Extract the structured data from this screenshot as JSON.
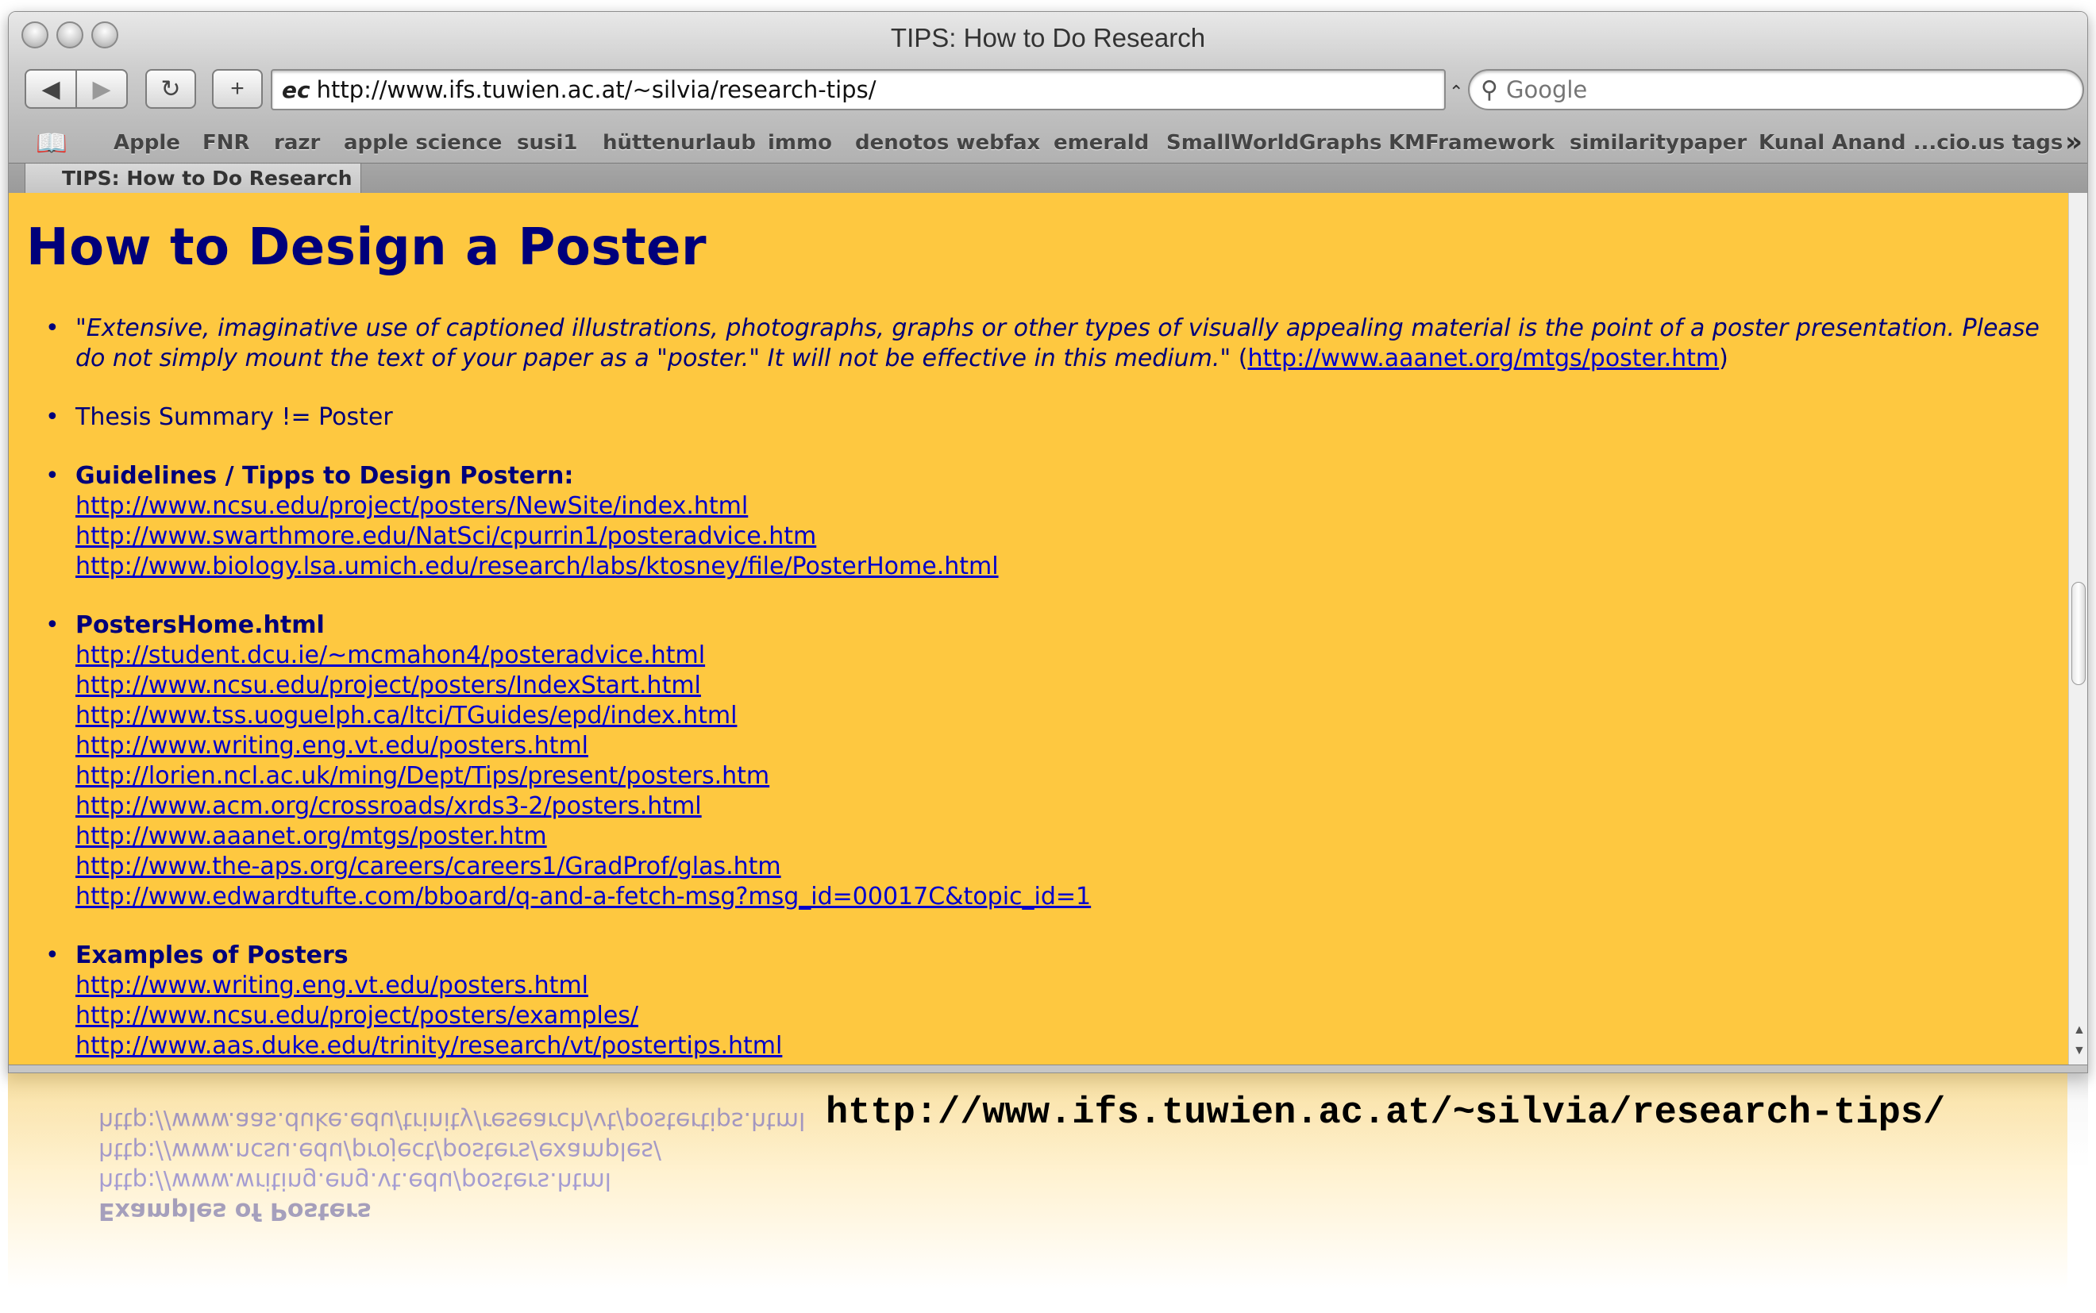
{
  "window": {
    "title": "TIPS: How to Do Research"
  },
  "toolbar": {
    "back_glyph": "◀",
    "forward_glyph": "▶",
    "reload_glyph": "↻",
    "add_glyph": "+",
    "site_icon_text": "ec",
    "address": "http://www.ifs.tuwien.ac.at/~silvia/research-tips/",
    "search_placeholder": "Google"
  },
  "bookmarks": {
    "items": [
      "Apple",
      "FNR",
      "razr",
      "apple science",
      "susi1",
      "hüttenurlaub",
      "immo",
      "denotos webfax",
      "emerald",
      "SmallWorldGraphs",
      "KMFramework",
      "similaritypaper",
      "Kunal Anand ...cio.us tags"
    ],
    "more_glyph": "»"
  },
  "tab": {
    "label": "TIPS: How to Do Research"
  },
  "page": {
    "heading": "How to Design a Poster",
    "quote_text": "\"Extensive, imaginative use of captioned illustrations, photographs, graphs or other types of visually appealing material is the point of  a poster presentation. Please do not simply mount the text of your paper as a \"poster.\" It will not be effective in this  medium.\"",
    "quote_link": "http://www.aaanet.org/mtgs/poster.htm",
    "thesis_text": "Thesis Summary != Poster",
    "guidelines": {
      "title": "Guidelines / Tipps to Design Postern:",
      "links": [
        "http://www.ncsu.edu/project/posters/NewSite/index.html",
        "http://www.swarthmore.edu/NatSci/cpurrin1/posteradvice.htm",
        "http://www.biology.lsa.umich.edu/research/labs/ktosney/file/PosterHome.html"
      ]
    },
    "postershome": {
      "title": "PostersHome.html",
      "links": [
        "http://student.dcu.ie/~mcmahon4/posteradvice.html",
        "http://www.ncsu.edu/project/posters/IndexStart.html",
        "http://www.tss.uoguelph.ca/ltci/TGuides/epd/index.html",
        "http://www.writing.eng.vt.edu/posters.html",
        "http://lorien.ncl.ac.uk/ming/Dept/Tips/present/posters.htm",
        "http://www.acm.org/crossroads/xrds3-2/posters.html",
        "http://www.aaanet.org/mtgs/poster.htm",
        "http://www.the-aps.org/careers/careers1/GradProf/glas.htm",
        "http://www.edwardtufte.com/bboard/q-and-a-fetch-msg?msg_id=00017C&topic_id=1"
      ]
    },
    "examples": {
      "title": "Examples of Posters",
      "links": [
        "http://www.writing.eng.vt.edu/posters.html",
        "http://www.ncsu.edu/project/posters/examples/",
        "http://www.aas.duke.edu/trinity/research/vt/postertips.html"
      ]
    }
  },
  "caption": {
    "url": "http://www.ifs.tuwien.ac.at/~silvia/research-tips/"
  },
  "colors": {
    "page_background": "#fec840",
    "heading": "#00007a",
    "link": "#0000cc"
  }
}
